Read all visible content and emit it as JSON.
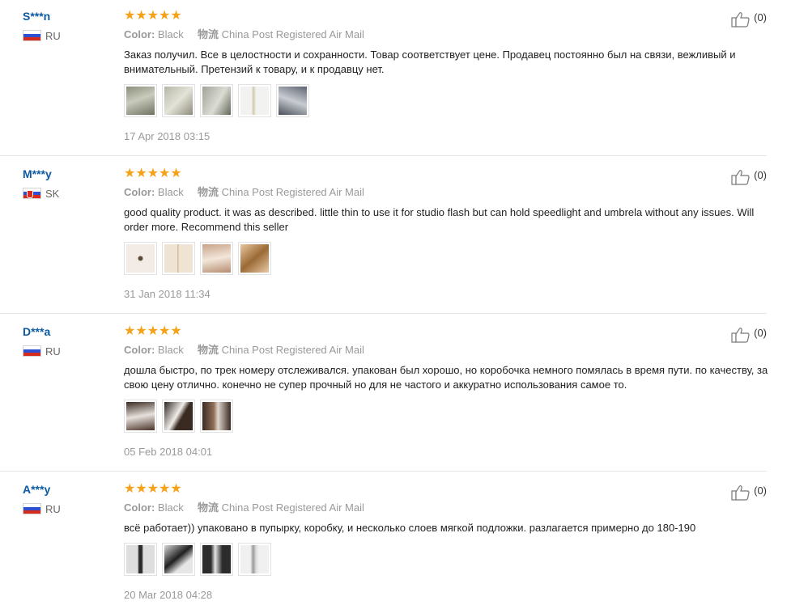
{
  "labels": {
    "color": "Color:",
    "shipping": "物流"
  },
  "reviews": [
    {
      "user": "S***n",
      "country_code": "RU",
      "flag": "ru",
      "stars": "★★★★★",
      "color_value": "Black",
      "shipping_value": "China Post Registered Air Mail",
      "text": "Заказ получил. Все в целостности и сохранности. Товар соответствует цене. Продавец постоянно был на связи, вежливый и внимательный. Претензий к товару, и к продавцу нет.",
      "photos": [
        "photo-1",
        "photo-2",
        "photo-3",
        "photo-4",
        "photo-5"
      ],
      "date": "17 Apr 2018 03:15",
      "helpful": "(0)"
    },
    {
      "user": "M***y",
      "country_code": "SK",
      "flag": "sk",
      "stars": "★★★★★",
      "color_value": "Black",
      "shipping_value": "China Post Registered Air Mail",
      "text": "good quality product. it was as described. little thin to use it for studio flash but can hold speedlight and umbrela without any issues. Will order more. Recommend this seller",
      "photos": [
        "photo-1",
        "photo-2",
        "photo-3",
        "photo-4"
      ],
      "date": "31 Jan 2018 11:34",
      "helpful": "(0)"
    },
    {
      "user": "D***a",
      "country_code": "RU",
      "flag": "ru",
      "stars": "★★★★★",
      "color_value": "Black",
      "shipping_value": "China Post Registered Air Mail",
      "text": "дошла быстро, по трек номеру отслеживался. упакован был хорошо, но коробочка немного помялась в время пути. по качеству, за свою цену отлично. конечно не супер прочный но для не частого и аккуратно использования самое то.",
      "photos": [
        "photo-1",
        "photo-2",
        "photo-3"
      ],
      "date": "05 Feb 2018 04:01",
      "helpful": "(0)"
    },
    {
      "user": "A***y",
      "country_code": "RU",
      "flag": "ru",
      "stars": "★★★★★",
      "color_value": "Black",
      "shipping_value": "China Post Registered Air Mail",
      "text": "всё работает)) упаковано в пупырку, коробку, и несколько слоев мягкой подложки. разлагается примерно до 180-190",
      "photos": [
        "photo-1",
        "photo-2",
        "photo-3",
        "photo-4"
      ],
      "date": "20 Mar 2018 04:28",
      "helpful": "(0)"
    }
  ]
}
